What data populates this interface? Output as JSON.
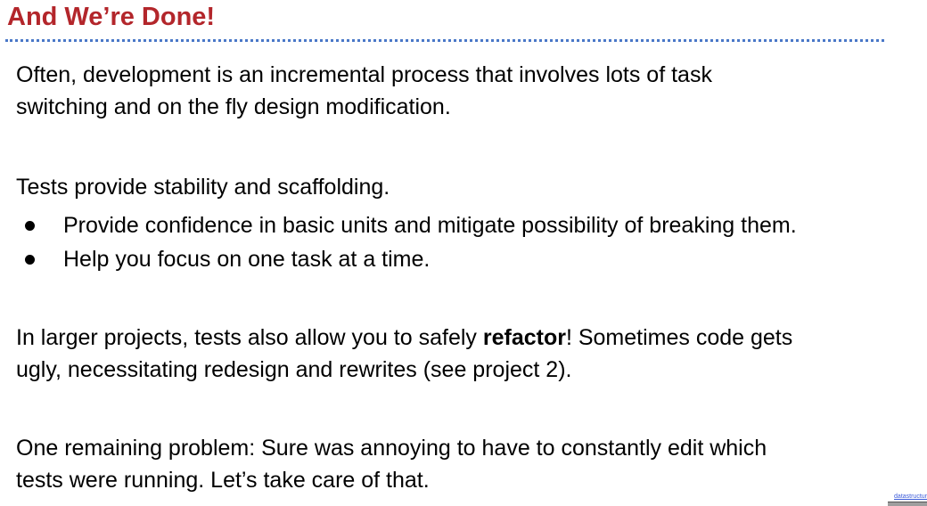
{
  "slide": {
    "title": "And We’re Done!",
    "paragraphs": {
      "p1_line1": "Often, development is an incremental process that involves lots of task",
      "p1_line2": "switching and on the fly design modification.",
      "p2": "Tests provide stability and scaffolding.",
      "p3_line1_before": "In larger projects, tests also allow you to safely ",
      "p3_line1_bold": "refactor",
      "p3_line1_after": "! Sometimes code gets",
      "p3_line2": "ugly, necessitating redesign and rewrites (see project 2).",
      "p4_line1": "One remaining problem: Sure was annoying to have to constantly edit which",
      "p4_line2": "tests were running. Let’s take care of that."
    },
    "bullets": [
      "Provide confidence in basic units and mitigate possibility of breaking them.",
      "Help you focus on one task at a time."
    ]
  },
  "footer": {
    "link_text": "datastructur",
    "license_icon": "creative-commons-icon"
  },
  "colors": {
    "title": "#b3262b",
    "rule": "#4a78c8",
    "link": "#3b5bd9"
  }
}
